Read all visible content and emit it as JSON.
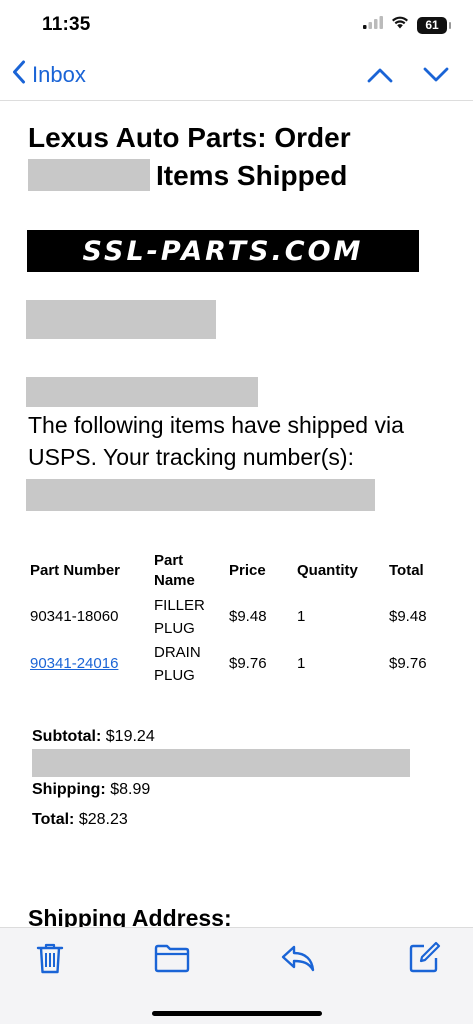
{
  "status_bar": {
    "time": "11:35",
    "battery": "61"
  },
  "nav": {
    "back_label": "Inbox",
    "accent_color": "#1a64d6"
  },
  "email": {
    "subject_line1": "Lexus Auto Parts: Order",
    "subject_line2": "Items Shipped",
    "logo_text": "SSL-PARTS.COM",
    "shipped_message": "The following items have shipped via USPS. Your tracking number(s):",
    "table": {
      "headers": [
        "Part Number",
        "Part Name",
        "Price",
        "Quantity",
        "Total"
      ],
      "rows": [
        {
          "part_number": "90341-18060",
          "part_name": "FILLER PLUG",
          "price": "$9.48",
          "quantity": "1",
          "total": "$9.48"
        },
        {
          "part_number": "90341-24016",
          "part_name": "DRAIN PLUG",
          "price": "$9.76",
          "quantity": "1",
          "total": "$9.76"
        }
      ]
    },
    "summary": {
      "subtotal_label": "Subtotal:",
      "subtotal_value": "$19.24",
      "shipping_label": "Shipping:",
      "shipping_value": "$8.99",
      "total_label": "Total:",
      "total_value": "$28.23"
    },
    "shipping_address_heading": "Shipping Address:"
  },
  "toolbar": {
    "icons": [
      "trash-icon",
      "folder-icon",
      "reply-icon",
      "compose-icon"
    ]
  }
}
